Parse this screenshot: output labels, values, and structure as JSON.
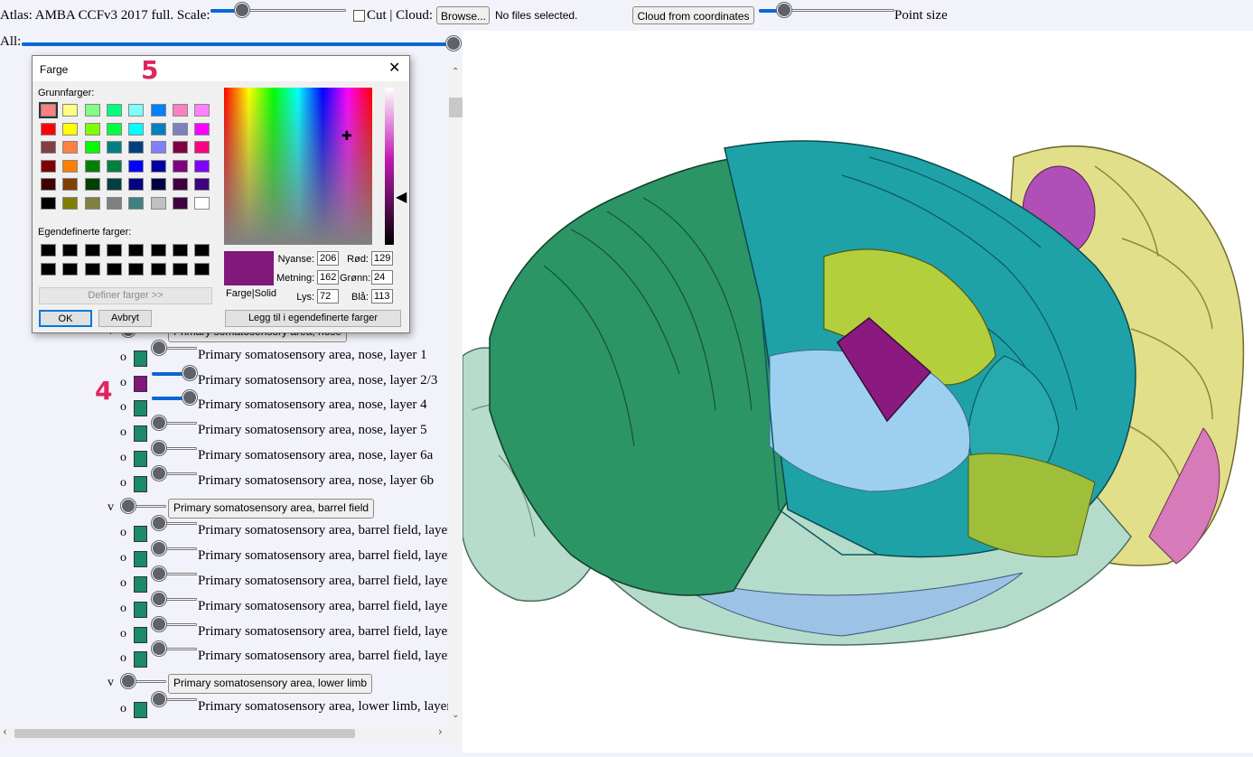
{
  "topbar": {
    "atlas_label": "Atlas: AMBA CCFv3 2017 full. Scale:",
    "scale_value": 0.2,
    "cut_label": "Cut | Cloud:",
    "browse_label": "Browse...",
    "files_text": "No files selected.",
    "cloud_coords_label": "Cloud from coordinates",
    "point_size_label": "Point size",
    "point_size_value": 0.15
  },
  "all_row": {
    "label": "All:",
    "value": 1.0
  },
  "annotations": {
    "a4": "4",
    "a5": "5"
  },
  "tree": {
    "rows": [
      {
        "type": "group",
        "marker": "v",
        "label": "Primary somatosensory area, nose",
        "slider": 0
      },
      {
        "type": "leaf",
        "marker": "o",
        "label": "Primary somatosensory area, nose, layer 1",
        "color": "#1a8a68",
        "slider": 0
      },
      {
        "type": "leaf",
        "marker": "o",
        "label": "Primary somatosensory area, nose, layer 2/3",
        "color": "#81187a",
        "slider": 1
      },
      {
        "type": "leaf",
        "marker": "o",
        "label": "Primary somatosensory area, nose, layer 4",
        "color": "#1a8a68",
        "slider": 1
      },
      {
        "type": "leaf",
        "marker": "o",
        "label": "Primary somatosensory area, nose, layer 5",
        "color": "#1a8a68",
        "slider": 0
      },
      {
        "type": "leaf",
        "marker": "o",
        "label": "Primary somatosensory area, nose, layer 6a",
        "color": "#1a8a68",
        "slider": 0
      },
      {
        "type": "leaf",
        "marker": "o",
        "label": "Primary somatosensory area, nose, layer 6b",
        "color": "#1a8a68",
        "slider": 0
      },
      {
        "type": "group",
        "marker": "v",
        "label": "Primary somatosensory area, barrel field",
        "slider": 0
      },
      {
        "type": "leaf",
        "marker": "o",
        "label": "Primary somatosensory area, barrel field, layer",
        "color": "#1a8a68",
        "slider": 0
      },
      {
        "type": "leaf",
        "marker": "o",
        "label": "Primary somatosensory area, barrel field, layer",
        "color": "#1a8a68",
        "slider": 0
      },
      {
        "type": "leaf",
        "marker": "o",
        "label": "Primary somatosensory area, barrel field, layer",
        "color": "#1a8a68",
        "slider": 0
      },
      {
        "type": "leaf",
        "marker": "o",
        "label": "Primary somatosensory area, barrel field, layer",
        "color": "#1a8a68",
        "slider": 0
      },
      {
        "type": "leaf",
        "marker": "o",
        "label": "Primary somatosensory area, barrel field, layer",
        "color": "#1a8a68",
        "slider": 0
      },
      {
        "type": "leaf",
        "marker": "o",
        "label": "Primary somatosensory area, barrel field, layer",
        "color": "#1a8a68",
        "slider": 0
      },
      {
        "type": "group",
        "marker": "v",
        "label": "Primary somatosensory area, lower limb",
        "slider": 0
      },
      {
        "type": "leaf",
        "marker": "o",
        "label": "Primary somatosensory area, lower limb, layer",
        "color": "#1a8a68",
        "slider": 0
      }
    ]
  },
  "dialog": {
    "title": "Farge",
    "basic_colors_label": "Grunnfarger:",
    "custom_colors_label": "Egendefinerte farger:",
    "define_button": "Definer farger >>",
    "ok_button": "OK",
    "cancel_button": "Avbryt",
    "add_custom_button": "Legg til i egendefinerte farger",
    "preview_label": "Farge|Solid",
    "preview_color": "#81187a",
    "hue_label": "Nyanse:",
    "hue": "206",
    "sat_label": "Metning:",
    "sat": "162",
    "lum_label": "Lys:",
    "lum": "72",
    "red_label": "Rød:",
    "red": "129",
    "green_label": "Grønn:",
    "green": "24",
    "blue_label": "Blå:",
    "blue": "113",
    "basic_colors": [
      "#ff8080",
      "#ffff80",
      "#80ff80",
      "#00ff80",
      "#80ffff",
      "#0080ff",
      "#ff80c0",
      "#ff80ff",
      "#ff0000",
      "#ffff00",
      "#80ff00",
      "#00ff40",
      "#00ffff",
      "#0080c0",
      "#8080c0",
      "#ff00ff",
      "#804040",
      "#ff8040",
      "#00ff00",
      "#008080",
      "#004080",
      "#8080ff",
      "#800040",
      "#ff0080",
      "#800000",
      "#ff8000",
      "#008000",
      "#008040",
      "#0000ff",
      "#0000a0",
      "#800080",
      "#8000ff",
      "#400000",
      "#804000",
      "#004000",
      "#004040",
      "#000080",
      "#000040",
      "#400040",
      "#400080",
      "#000000",
      "#808000",
      "#808040",
      "#808080",
      "#408080",
      "#c0c0c0",
      "#400040",
      "#ffffff"
    ],
    "custom_colors": [
      "#000000",
      "#000000",
      "#000000",
      "#000000",
      "#000000",
      "#000000",
      "#000000",
      "#000000",
      "#000000",
      "#000000",
      "#000000",
      "#000000",
      "#000000",
      "#000000",
      "#000000",
      "#000000"
    ]
  }
}
